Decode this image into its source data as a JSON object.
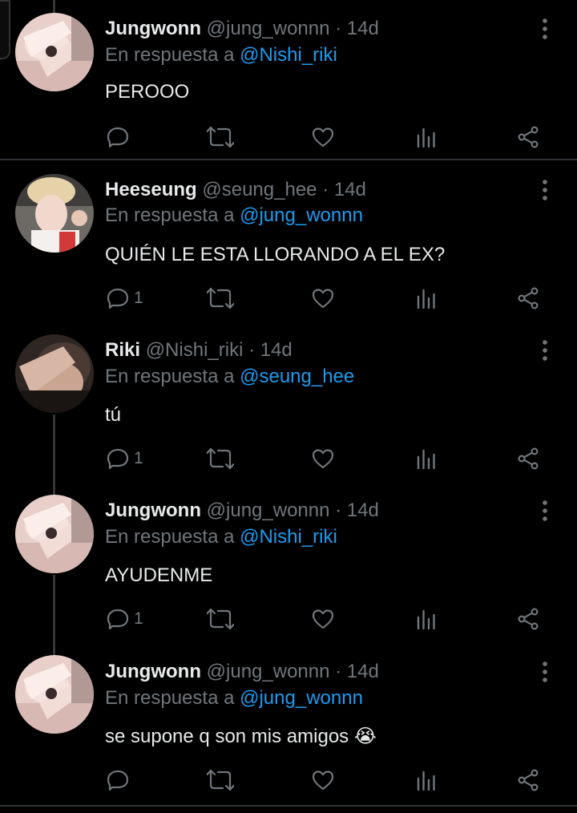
{
  "colors": {
    "background": "#000000",
    "text": "#e7e9ea",
    "muted": "#71767b",
    "link": "#1d9bf0"
  },
  "labels": {
    "reply_prefix": "En respuesta a"
  },
  "tweets": [
    {
      "name": "Jungwonn",
      "meta": "@jung_wonnn · 14d",
      "reply_to": "@Nishi_riki",
      "text": "PEROOO",
      "reply_count": "",
      "avatar": "jungwon-avatar"
    },
    {
      "name": "Heeseung",
      "meta": "@seung_hee · 14d",
      "reply_to": "@jung_wonnn",
      "text": "QUIÉN LE ESTA LLORANDO A EL EX?",
      "reply_count": "1",
      "avatar": "heeseung-avatar"
    },
    {
      "name": "Riki",
      "meta": "@Nishi_riki · 14d",
      "reply_to": "@seung_hee",
      "text": "tú",
      "reply_count": "1",
      "avatar": "riki-avatar"
    },
    {
      "name": "Jungwonn",
      "meta": "@jung_wonnn · 14d",
      "reply_to": "@Nishi_riki",
      "text": "AYUDENME",
      "reply_count": "1",
      "avatar": "jungwon-avatar"
    },
    {
      "name": "Jungwonn",
      "meta": "@jung_wonnn · 14d",
      "reply_to": "@jung_wonnn",
      "text": "se supone q son mis amigos 😭",
      "reply_count": "",
      "avatar": "jungwon-avatar"
    }
  ]
}
